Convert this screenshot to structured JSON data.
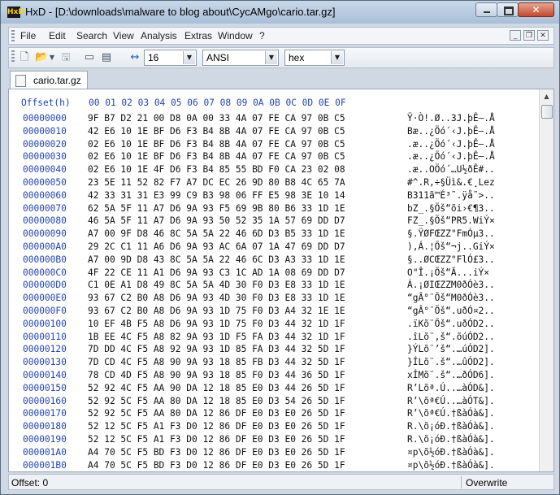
{
  "window": {
    "title": "HxD - [D:\\downloads\\malware to blog about\\CycAMgo\\cario.tar.gz]"
  },
  "menu": {
    "items": [
      "File",
      "Edit",
      "Search",
      "View",
      "Analysis",
      "Extras",
      "Window",
      "?"
    ]
  },
  "toolbar": {
    "bytes_per_row": "16",
    "charset": "ANSI",
    "offset_base": "hex"
  },
  "tab": {
    "filename": "cario.tar.gz"
  },
  "hex": {
    "offset_header": "Offset(h)",
    "column_header": "00 01 02 03 04 05 06 07 08 09 0A 0B 0C 0D 0E 0F",
    "rows": [
      {
        "offset": "00000000",
        "bytes": "9F B7 D2 21 00 D8 0A 00 33 4A 07 FE CA 97 0B C5",
        "text": "Ÿ·Ò!.Ø..3J.þÊ—.Å"
      },
      {
        "offset": "00000010",
        "bytes": "42 E6 10 1E BF D6 F3 B4 8B 4A 07 FE CA 97 0B C5",
        "text": "Bæ..¿Öó´‹J.þÊ—.Å"
      },
      {
        "offset": "00000020",
        "bytes": "02 E6 10 1E BF D6 F3 B4 8B 4A 07 FE CA 97 0B C5",
        "text": ".æ..¿Öó´‹J.þÊ—.Å"
      },
      {
        "offset": "00000030",
        "bytes": "02 E6 10 1E BF D6 F3 B4 8B 4A 07 FE CA 97 0B C5",
        "text": ".æ..¿Öó´‹J.þÊ—.Å"
      },
      {
        "offset": "00000040",
        "bytes": "02 E6 10 1E 4F D6 F3 B4 85 55 BD F0 CA 23 02 08",
        "text": ".æ..OÖó´…U½ðÊ#.."
      },
      {
        "offset": "00000050",
        "bytes": "23 5E 11 52 82 F7 A7 DC EC 26 9D 80 B8 4C 65 7A",
        "text": "#^.R‚÷§Üì&.€¸Lez"
      },
      {
        "offset": "00000060",
        "bytes": "42 33 31 31 E3 99 C9 B3 98 06 FF E5 98 3E 10 14",
        "text": "B311ã™É³˜.ÿå˜>.."
      },
      {
        "offset": "00000070",
        "bytes": "62 5A 5F 11 A7 D6 9A 93 F5 69 9B 80 B6 33 1D 1E",
        "text": "bZ_.§Öš“õi›€¶3.."
      },
      {
        "offset": "00000080",
        "bytes": "46 5A 5F 11 A7 D6 9A 93 50 52 35 1A 57 69 DD D7",
        "text": "FZ_.§Öš“PR5.WiÝ×"
      },
      {
        "offset": "00000090",
        "bytes": "A7 00 9F D8 46 8C 5A 5A 22 46 6D D3 B5 33 1D 1E",
        "text": "§.ŸØFŒZZ\"FmÓµ3.."
      },
      {
        "offset": "000000A0",
        "bytes": "29 2C C1 11 A6 D6 9A 93 AC 6A 07 1A 47 69 DD D7",
        "text": "),Á.¦Öš“¬j..GiÝ×"
      },
      {
        "offset": "000000B0",
        "bytes": "A7 00 9D D8 43 8C 5A 5A 22 46 6C D3 A3 33 1D 1E",
        "text": "§..ØCŒZZ\"FlÓ£3.."
      },
      {
        "offset": "000000C0",
        "bytes": "4F 22 CE 11 A1 D6 9A 93 C3 1C AD 1A 08 69 DD D7",
        "text": "O\"Î.¡Öš“Ã.­..iÝ×"
      },
      {
        "offset": "000000D0",
        "bytes": "C1 0E A1 D8 49 8C 5A 5A 4D 30 F0 D3 E8 33 1D 1E",
        "text": "Á.¡ØIŒZZM0ðÓè3.."
      },
      {
        "offset": "000000E0",
        "bytes": "93 67 C2 B0 A8 D6 9A 93 4D 30 F0 D3 E8 33 1D 1E",
        "text": "“gÂ°¨Öš“M0ðÓè3.."
      },
      {
        "offset": "000000F0",
        "bytes": "93 67 C2 B0 A8 D6 9A 93 1D 75 F0 D3 A4 32 1E 1E",
        "text": "“gÂ°¨Öš“.uðÓ¤2.."
      },
      {
        "offset": "00000100",
        "bytes": "10 EF 4B F5 A8 D6 9A 93 1D 75 F0 D3 44 32 1D 1F",
        "text": ".ïKõ¨Öš“.uðÓD2.."
      },
      {
        "offset": "00000110",
        "bytes": "1B EE 4C F5 A8 82 9A 93 1D F5 FA D3 44 32 1D 1F",
        "text": ".îLõ¨‚š“.õúÓD2.."
      },
      {
        "offset": "00000120",
        "bytes": "7D DD 4C F5 A8 92 9A 93 1D 85 FA D3 44 32 5D 1F",
        "text": "}ÝLõ¨’š“.…úÓD2]."
      },
      {
        "offset": "00000130",
        "bytes": "7D CD 4C F5 A8 90 9A 93 18 85 FB D3 44 32 5D 1F",
        "text": "}ÍLõ¨.š“.…ûÓD2]."
      },
      {
        "offset": "00000140",
        "bytes": "78 CD 4D F5 A8 90 9A 93 18 85 F0 D3 44 36 5D 1F",
        "text": "xÍMõ¨.š“.…ðÓD6]."
      },
      {
        "offset": "00000150",
        "bytes": "52 92 4C F5 AA 90 DA 12 18 85 E0 D3 44 26 5D 1F",
        "text": "R’Lõª.Ú..…àÓD&]."
      },
      {
        "offset": "00000160",
        "bytes": "52 92 5C F5 AA 80 DA 12 18 85 E0 D3 54 26 5D 1F",
        "text": "R’\\õª€Ú..…àÓT&]."
      },
      {
        "offset": "00000170",
        "bytes": "52 92 5C F5 AA 80 DA 12 86 DF E0 D3 E0 26 5D 1F",
        "text": "R’\\õª€Ú.†ßàÓà&]."
      },
      {
        "offset": "00000180",
        "bytes": "52 12 5C F5 A1 F3 D0 12 86 DF E0 D3 E0 26 5D 1F",
        "text": "R.\\õ¡óÐ.†ßàÓà&]."
      },
      {
        "offset": "00000190",
        "bytes": "52 12 5C F5 A1 F3 D0 12 86 DF E0 D3 E0 26 5D 1F",
        "text": "R.\\õ¡óÐ.†ßàÓà&]."
      },
      {
        "offset": "000001A0",
        "bytes": "A4 70 5C F5 BD F3 D0 12 86 DF E0 D3 E0 26 5D 1F",
        "text": "¤p\\õ½óÐ.†ßàÓà&]."
      },
      {
        "offset": "000001B0",
        "bytes": "A4 70 5C F5 BD F3 D0 12 86 DF E0 D3 E0 26 5D 1F",
        "text": "¤p\\õ½óÐ.†ßàÓà&]."
      }
    ]
  },
  "status": {
    "offset": "Offset: 0",
    "mode": "Overwrite"
  }
}
